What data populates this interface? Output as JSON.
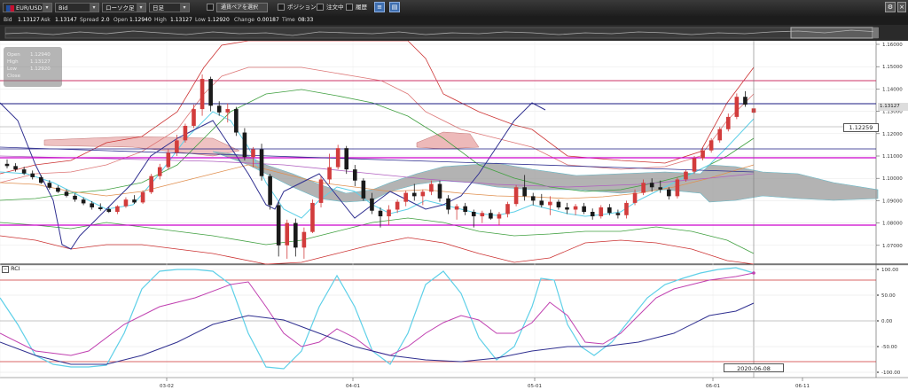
{
  "toolbar": {
    "pair": "EUR/USD",
    "price_type": "Bid",
    "chart_type": "ローソク足",
    "timeframe": "日足",
    "compare_label": "通貨ペアを選択",
    "position_label": "ポジション",
    "orders_label": "注文中",
    "history_label": "履歴"
  },
  "quote": {
    "bid_label": "Bid",
    "bid": "1.13127",
    "ask_label": "Ask",
    "ask": "1.13147",
    "spread_label": "Spread",
    "spread": "2.0",
    "open_label": "Open",
    "open": "1.12940",
    "high_label": "High",
    "high": "1.13127",
    "low_label": "Low",
    "low": "1.12920",
    "change_label": "Change",
    "change": "0.00187",
    "time_label": "Time",
    "time": "08:33"
  },
  "ohlc_box": {
    "open_label": "Open",
    "open": "1.12940",
    "high_label": "High",
    "high": "1.13127",
    "low_label": "Low",
    "low": "1.12920",
    "close_label": "Close"
  },
  "price_axis": {
    "ticks": [
      "1.16000",
      "1.15000",
      "1.14000",
      "1.13000",
      "1.12000",
      "1.11000",
      "1.10000",
      "1.09000",
      "1.08000",
      "1.07000",
      "1.06000"
    ],
    "crosshair_price": "1.12259",
    "last_price": "1.13127"
  },
  "rci": {
    "label": "RCI",
    "ticks": [
      "100.00",
      "50.00",
      "0.00",
      "-50.00",
      "-100.00"
    ]
  },
  "time_axis": {
    "ticks": [
      "03-02",
      "04-01",
      "05-01",
      "06-01",
      "06-11"
    ],
    "crosshair_date": "2020-06-08"
  },
  "colors": {
    "toolbar_bg": "#2b2b2b",
    "bull": "#d23c3c",
    "bear": "#1a1a1a",
    "magenta_line": "#cc00cc",
    "navy_line": "#1a1a80",
    "bb_mid": "#40a040",
    "rci_fast": "#5fd0e8",
    "rci_mid": "#c040b0",
    "rci_slow": "#303090"
  },
  "chart_data": {
    "type": "candlestick",
    "price_range": [
      1.06,
      1.16
    ],
    "candles": [
      {
        "o": 1.1065,
        "h": 1.1085,
        "l": 1.1045,
        "c": 1.1055
      },
      {
        "o": 1.1055,
        "h": 1.1068,
        "l": 1.103,
        "c": 1.104
      },
      {
        "o": 1.104,
        "h": 1.1052,
        "l": 1.1015,
        "c": 1.1022
      },
      {
        "o": 1.1022,
        "h": 1.1035,
        "l": 1.0995,
        "c": 1.1005
      },
      {
        "o": 1.1005,
        "h": 1.1015,
        "l": 1.0975,
        "c": 1.098
      },
      {
        "o": 1.098,
        "h": 1.0992,
        "l": 1.095,
        "c": 1.0958
      },
      {
        "o": 1.0958,
        "h": 1.0968,
        "l": 1.0935,
        "c": 1.094
      },
      {
        "o": 1.094,
        "h": 1.095,
        "l": 1.0915,
        "c": 1.0922
      },
      {
        "o": 1.0922,
        "h": 1.0932,
        "l": 1.0895,
        "c": 1.0905
      },
      {
        "o": 1.0905,
        "h": 1.0915,
        "l": 1.088,
        "c": 1.0888
      },
      {
        "o": 1.0888,
        "h": 1.0898,
        "l": 1.086,
        "c": 1.087
      },
      {
        "o": 1.087,
        "h": 1.0888,
        "l": 1.0855,
        "c": 1.0862
      },
      {
        "o": 1.0862,
        "h": 1.0872,
        "l": 1.0845,
        "c": 1.085
      },
      {
        "o": 1.085,
        "h": 1.088,
        "l": 1.084,
        "c": 1.0875
      },
      {
        "o": 1.0875,
        "h": 1.0915,
        "l": 1.0868,
        "c": 1.0905
      },
      {
        "o": 1.0905,
        "h": 1.0925,
        "l": 1.0885,
        "c": 1.0892
      },
      {
        "o": 1.0892,
        "h": 1.0945,
        "l": 1.0885,
        "c": 1.0938
      },
      {
        "o": 1.0938,
        "h": 1.102,
        "l": 1.093,
        "c": 1.101
      },
      {
        "o": 1.101,
        "h": 1.1065,
        "l": 1.0995,
        "c": 1.105
      },
      {
        "o": 1.105,
        "h": 1.113,
        "l": 1.104,
        "c": 1.1115
      },
      {
        "o": 1.1115,
        "h": 1.1195,
        "l": 1.11,
        "c": 1.117
      },
      {
        "o": 1.117,
        "h": 1.1245,
        "l": 1.116,
        "c": 1.1235
      },
      {
        "o": 1.1235,
        "h": 1.133,
        "l": 1.1225,
        "c": 1.131
      },
      {
        "o": 1.131,
        "h": 1.1465,
        "l": 1.128,
        "c": 1.1445
      },
      {
        "o": 1.1445,
        "h": 1.1455,
        "l": 1.13,
        "c": 1.1325
      },
      {
        "o": 1.1325,
        "h": 1.1345,
        "l": 1.128,
        "c": 1.1295
      },
      {
        "o": 1.1295,
        "h": 1.1335,
        "l": 1.125,
        "c": 1.131
      },
      {
        "o": 1.131,
        "h": 1.132,
        "l": 1.119,
        "c": 1.1205
      },
      {
        "o": 1.1205,
        "h": 1.1225,
        "l": 1.108,
        "c": 1.1095
      },
      {
        "o": 1.1095,
        "h": 1.114,
        "l": 1.105,
        "c": 1.113
      },
      {
        "o": 1.113,
        "h": 1.1155,
        "l": 1.099,
        "c": 1.101
      },
      {
        "o": 1.101,
        "h": 1.102,
        "l": 1.086,
        "c": 1.088
      },
      {
        "o": 1.088,
        "h": 1.0895,
        "l": 1.065,
        "c": 1.07
      },
      {
        "o": 1.07,
        "h": 1.0815,
        "l": 1.064,
        "c": 1.08
      },
      {
        "o": 1.08,
        "h": 1.082,
        "l": 1.065,
        "c": 1.069
      },
      {
        "o": 1.069,
        "h": 1.078,
        "l": 1.064,
        "c": 1.076
      },
      {
        "o": 1.076,
        "h": 1.0905,
        "l": 1.0755,
        "c": 1.089
      },
      {
        "o": 1.089,
        "h": 1.101,
        "l": 1.087,
        "c": 1.0995
      },
      {
        "o": 1.0995,
        "h": 1.111,
        "l": 1.0975,
        "c": 1.105
      },
      {
        "o": 1.105,
        "h": 1.115,
        "l": 1.104,
        "c": 1.1135
      },
      {
        "o": 1.1135,
        "h": 1.1145,
        "l": 1.102,
        "c": 1.104
      },
      {
        "o": 1.104,
        "h": 1.106,
        "l": 1.0965,
        "c": 1.099
      },
      {
        "o": 1.099,
        "h": 1.1,
        "l": 1.09,
        "c": 1.091
      },
      {
        "o": 1.091,
        "h": 1.0935,
        "l": 1.084,
        "c": 1.0855
      },
      {
        "o": 1.0855,
        "h": 1.087,
        "l": 1.078,
        "c": 1.083
      },
      {
        "o": 1.083,
        "h": 1.088,
        "l": 1.079,
        "c": 1.086
      },
      {
        "o": 1.086,
        "h": 1.0905,
        "l": 1.0845,
        "c": 1.0895
      },
      {
        "o": 1.0895,
        "h": 1.0945,
        "l": 1.0875,
        "c": 1.0935
      },
      {
        "o": 1.0935,
        "h": 1.0975,
        "l": 1.09,
        "c": 1.092
      },
      {
        "o": 1.092,
        "h": 1.095,
        "l": 1.088,
        "c": 1.094
      },
      {
        "o": 1.094,
        "h": 1.099,
        "l": 1.0925,
        "c": 1.0975
      },
      {
        "o": 1.0975,
        "h": 1.099,
        "l": 1.0895,
        "c": 1.091
      },
      {
        "o": 1.091,
        "h": 1.0925,
        "l": 1.084,
        "c": 1.086
      },
      {
        "o": 1.086,
        "h": 1.0885,
        "l": 1.0815,
        "c": 1.0875
      },
      {
        "o": 1.0875,
        "h": 1.089,
        "l": 1.0835,
        "c": 1.085
      },
      {
        "o": 1.085,
        "h": 1.086,
        "l": 1.078,
        "c": 1.083
      },
      {
        "o": 1.083,
        "h": 1.0855,
        "l": 1.08,
        "c": 1.0845
      },
      {
        "o": 1.0845,
        "h": 1.086,
        "l": 1.0815,
        "c": 1.082
      },
      {
        "o": 1.082,
        "h": 1.085,
        "l": 1.079,
        "c": 1.084
      },
      {
        "o": 1.084,
        "h": 1.0895,
        "l": 1.0825,
        "c": 1.0885
      },
      {
        "o": 1.0885,
        "h": 1.097,
        "l": 1.0875,
        "c": 1.096
      },
      {
        "o": 1.096,
        "h": 1.1015,
        "l": 1.09,
        "c": 1.092
      },
      {
        "o": 1.092,
        "h": 1.0935,
        "l": 1.088,
        "c": 1.09
      },
      {
        "o": 1.09,
        "h": 1.093,
        "l": 1.087,
        "c": 1.088
      },
      {
        "o": 1.088,
        "h": 1.092,
        "l": 1.0835,
        "c": 1.0895
      },
      {
        "o": 1.0895,
        "h": 1.0905,
        "l": 1.086,
        "c": 1.087
      },
      {
        "o": 1.087,
        "h": 1.089,
        "l": 1.084,
        "c": 1.086
      },
      {
        "o": 1.086,
        "h": 1.0885,
        "l": 1.0835,
        "c": 1.0875
      },
      {
        "o": 1.0875,
        "h": 1.089,
        "l": 1.084,
        "c": 1.085
      },
      {
        "o": 1.085,
        "h": 1.0865,
        "l": 1.0815,
        "c": 1.083
      },
      {
        "o": 1.083,
        "h": 1.088,
        "l": 1.082,
        "c": 1.087
      },
      {
        "o": 1.087,
        "h": 1.0885,
        "l": 1.0835,
        "c": 1.0845
      },
      {
        "o": 1.0845,
        "h": 1.086,
        "l": 1.082,
        "c": 1.0835
      },
      {
        "o": 1.0835,
        "h": 1.09,
        "l": 1.082,
        "c": 1.089
      },
      {
        "o": 1.089,
        "h": 1.095,
        "l": 1.088,
        "c": 1.0935
      },
      {
        "o": 1.0935,
        "h": 1.0995,
        "l": 1.0925,
        "c": 1.098
      },
      {
        "o": 1.098,
        "h": 1.1,
        "l": 1.094,
        "c": 1.096
      },
      {
        "o": 1.096,
        "h": 1.099,
        "l": 1.0935,
        "c": 1.095
      },
      {
        "o": 1.095,
        "h": 1.096,
        "l": 1.0905,
        "c": 1.092
      },
      {
        "o": 1.092,
        "h": 1.1005,
        "l": 1.091,
        "c": 1.0995
      },
      {
        "o": 1.0995,
        "h": 1.104,
        "l": 1.0985,
        "c": 1.103
      },
      {
        "o": 1.103,
        "h": 1.11,
        "l": 1.102,
        "c": 1.109
      },
      {
        "o": 1.109,
        "h": 1.114,
        "l": 1.108,
        "c": 1.1125
      },
      {
        "o": 1.1125,
        "h": 1.118,
        "l": 1.1115,
        "c": 1.117
      },
      {
        "o": 1.117,
        "h": 1.123,
        "l": 1.116,
        "c": 1.122
      },
      {
        "o": 1.122,
        "h": 1.129,
        "l": 1.121,
        "c": 1.1275
      },
      {
        "o": 1.1275,
        "h": 1.138,
        "l": 1.1265,
        "c": 1.1365
      },
      {
        "o": 1.1365,
        "h": 1.139,
        "l": 1.132,
        "c": 1.133
      },
      {
        "o": 1.1294,
        "h": 1.1313,
        "l": 1.1292,
        "c": 1.1313
      }
    ]
  }
}
